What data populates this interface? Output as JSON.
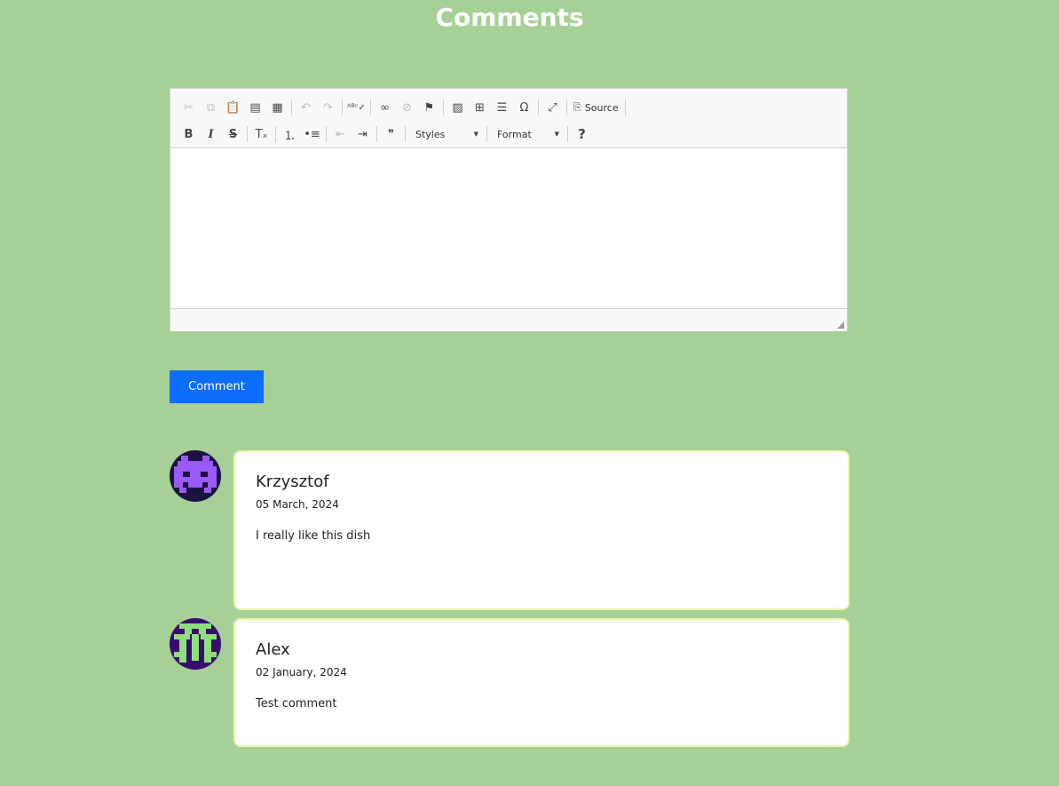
{
  "page": {
    "title": "Comments"
  },
  "editor": {
    "toolbar_row1": [
      {
        "icon": "cut-icon",
        "glyph": "✂",
        "disabled": true
      },
      {
        "icon": "copy-icon",
        "glyph": "⧉",
        "disabled": true
      },
      {
        "icon": "paste-icon",
        "glyph": "📋",
        "disabled": false
      },
      {
        "icon": "paste-text-icon",
        "glyph": "▤",
        "disabled": false
      },
      {
        "icon": "paste-word-icon",
        "glyph": "▦",
        "disabled": false
      },
      {
        "sep": true
      },
      {
        "icon": "undo-icon",
        "glyph": "↶",
        "disabled": true
      },
      {
        "icon": "redo-icon",
        "glyph": "↷",
        "disabled": true
      },
      {
        "sep": true
      },
      {
        "icon": "spellcheck-icon",
        "glyph": "ᴬᴮᶜ✓",
        "disabled": false
      },
      {
        "sep": true
      },
      {
        "icon": "link-icon",
        "glyph": "∞",
        "disabled": false
      },
      {
        "icon": "unlink-icon",
        "glyph": "⊘",
        "disabled": true
      },
      {
        "icon": "anchor-flag-icon",
        "glyph": "⚑",
        "disabled": false
      },
      {
        "sep": true
      },
      {
        "icon": "image-icon",
        "glyph": "▨",
        "disabled": false
      },
      {
        "icon": "table-icon",
        "glyph": "⊞",
        "disabled": false
      },
      {
        "icon": "horizontal-line-icon",
        "glyph": "☰",
        "disabled": false
      },
      {
        "icon": "special-char-icon",
        "glyph": "Ω",
        "disabled": false
      },
      {
        "sep": true
      },
      {
        "icon": "maximize-icon",
        "glyph": "⤢",
        "disabled": false
      },
      {
        "sep": true
      }
    ],
    "source_label": "Source",
    "toolbar_row2": [
      {
        "icon": "bold-icon",
        "glyph": "B",
        "disabled": false
      },
      {
        "icon": "italic-icon",
        "glyph": "I",
        "disabled": false
      },
      {
        "icon": "strike-icon",
        "glyph": "S",
        "disabled": false
      },
      {
        "sep": true
      },
      {
        "icon": "remove-format-icon",
        "glyph": "Tₓ",
        "disabled": false
      },
      {
        "sep": true
      },
      {
        "icon": "numbered-list-icon",
        "glyph": "⒈",
        "disabled": false
      },
      {
        "icon": "bulleted-list-icon",
        "glyph": "•≡",
        "disabled": false
      },
      {
        "sep": true
      },
      {
        "icon": "outdent-icon",
        "glyph": "⇤",
        "disabled": true
      },
      {
        "icon": "indent-icon",
        "glyph": "⇥",
        "disabled": false
      },
      {
        "sep": true
      },
      {
        "icon": "blockquote-icon",
        "glyph": "❞",
        "disabled": false
      },
      {
        "sep": true
      }
    ],
    "styles_label": "Styles",
    "format_label": "Format",
    "help_glyph": "?",
    "content": ""
  },
  "comment_button": {
    "label": "Comment"
  },
  "comments": [
    {
      "author": "Krzysztof",
      "date": "05 March, 2024",
      "text": "I really like this dish",
      "avatar_bg": "#1a1240",
      "avatar_fg": "#9b59f5"
    },
    {
      "author": "Alex",
      "date": "02 January, 2024",
      "text": "Test comment",
      "avatar_bg": "#3a0c6e",
      "avatar_fg": "#8ee07a"
    }
  ],
  "colors": {
    "background": "#a6d096",
    "primary": "#0d6efd",
    "card_border": "#e8f5b0"
  }
}
